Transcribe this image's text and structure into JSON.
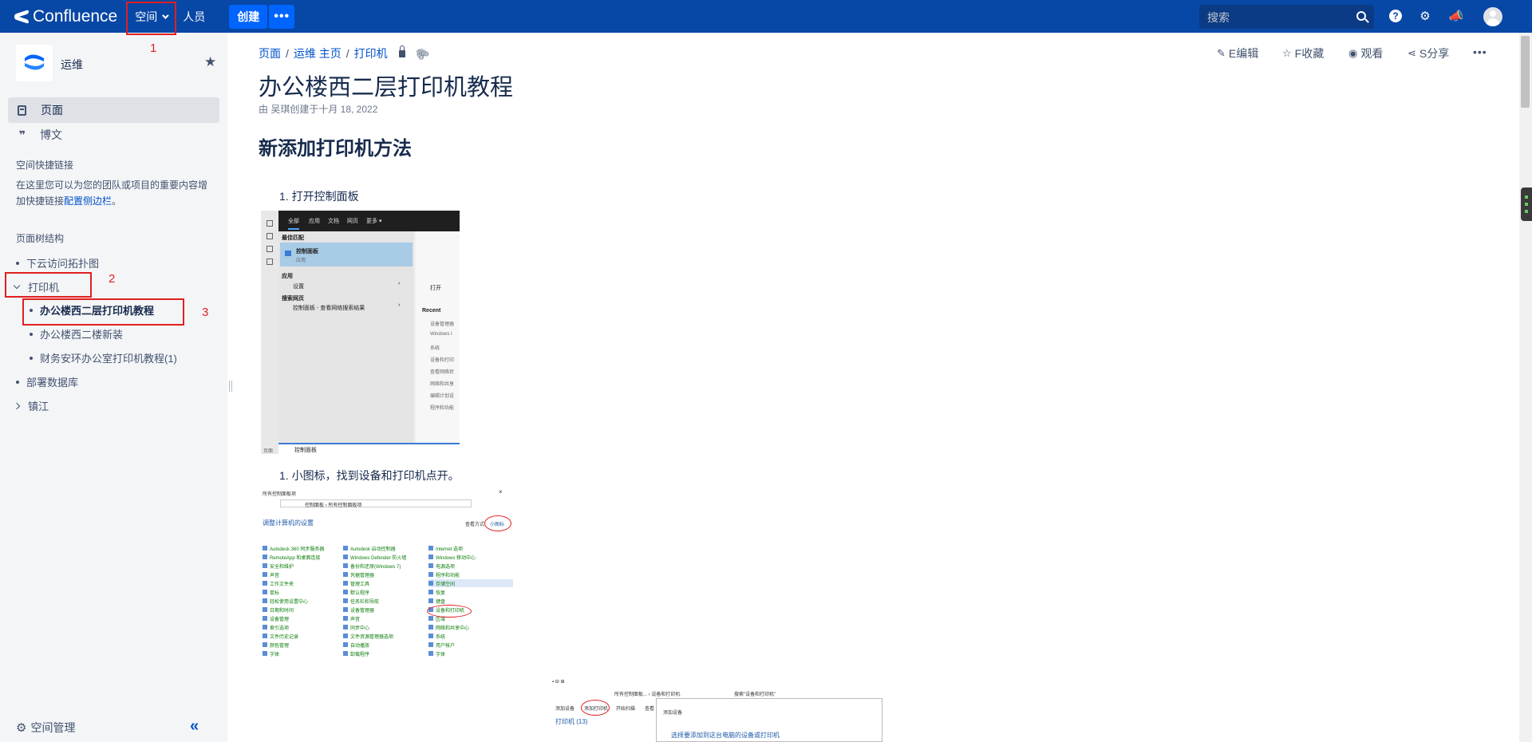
{
  "topnav": {
    "logo": "Confluence",
    "spaces": "空间",
    "people": "人员",
    "create": "创建",
    "more": "•••",
    "search_placeholder": "搜索"
  },
  "annotations": [
    "1",
    "2",
    "3"
  ],
  "sidebar": {
    "space_name": "运维",
    "nav": [
      {
        "label": "页面",
        "icon": "page-icon"
      },
      {
        "label": "博文",
        "icon": "quote-icon"
      }
    ],
    "shortcuts_heading": "空间快捷链接",
    "shortcuts_text": "在这里您可以为您的团队或项目的重要内容增加快捷链接",
    "shortcuts_link": "配置侧边栏",
    "shortcuts_end": "。",
    "tree_heading": "页面树结构",
    "tree": [
      "下云访问拓扑图",
      "打印机",
      "办公楼西二层打印机教程",
      "办公楼西二楼新装",
      "财务安环办公室打印机教程(1)",
      "部署数据库",
      "镇江"
    ],
    "admin": "空间管理"
  },
  "breadcrumb": [
    "页面",
    "运维 主页",
    "打印机"
  ],
  "actions": {
    "edit": "E编辑",
    "favorite": "F收藏",
    "watch": "观看",
    "share": "S分享",
    "more": "•••"
  },
  "page": {
    "title": "办公楼西二层打印机教程",
    "byline": "由 吴琪创建于十月 18, 2022",
    "heading": "新添加打印机方法",
    "step1": "1. 打开控制面板",
    "step2": "1. 小图标，找到设备和打印机点开。"
  },
  "screenshot1": {
    "tabs": [
      "全部",
      "应用",
      "文档",
      "网页",
      "更多 ▾"
    ],
    "best_match": "最佳匹配",
    "result_title": "控制面板",
    "result_sub": "应用",
    "apps": "应用",
    "settings": "设置",
    "web_search": "搜索网页",
    "web_item": "控制面板 - 查看网络搜索结果",
    "open": "打开",
    "recent": "Recent",
    "recent_items": [
      "设备管理器",
      "Windows I",
      "系统",
      "设备和打印",
      "查看网络状",
      "网络和共享",
      "编辑计划设",
      "程序和功能"
    ],
    "search_text": "控制面板",
    "page_label": "页面"
  },
  "screenshot2": {
    "window_title": "所有控制面板项",
    "address": "控制面板 › 所有控制面板项",
    "heading": "调整计算机的设置",
    "view_by": "查看方式:",
    "view_value": "小图标",
    "col1": [
      "Autodesk 360 同步服务器",
      "RemoteApp 和桌面连接",
      "安全和维护",
      "声音",
      "工作文件夹",
      "鼠标",
      "轻松使用设置中心",
      "日期和时间",
      "设备管理",
      "索引选项",
      "文件历史记录",
      "颜色管理",
      "字体"
    ],
    "col2": [
      "Autodesk 启动控制器",
      "Windows Defender 防火墙",
      "备份和还原(Windows 7)",
      "凭据管理器",
      "管理工具",
      "默认程序",
      "任务栏和导航",
      "设备管理器",
      "声音",
      "同步中心",
      "文件资源管理器选项",
      "自动播放",
      "卸载程序"
    ],
    "col3": [
      "Internet 选项",
      "Windows 移动中心",
      "电源选项",
      "程序和功能",
      "存储空间",
      "恢复",
      "键盘",
      "设备和打印机",
      "区域",
      "网络和共享中心",
      "系统",
      "用户帐户",
      "字体"
    ]
  },
  "screenshot3": {
    "address": "所有控制面板... › 设备和打印机",
    "search": "搜索\"设备和打印机\"",
    "add_device": "添加设备",
    "add_printer": "添加打印机",
    "start_scan": "开始扫描",
    "view": "查看",
    "printers": "打印机 (13)",
    "dialog_title": "添加设备",
    "dialog_text": "选择要添加到这台电脑的设备或打印机"
  },
  "colors": {
    "topnav_bg": "#0747a6",
    "create_bg": "#0065ff",
    "sidebar_bg": "#f4f5f7",
    "link": "#0052cc",
    "annotation": "#e02020"
  }
}
